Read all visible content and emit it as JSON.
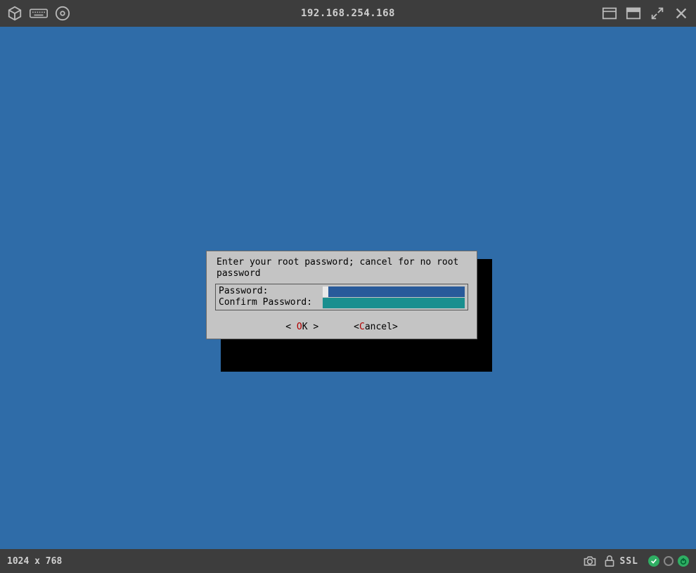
{
  "topbar": {
    "title": "192.168.254.168"
  },
  "dialog": {
    "message": "Enter your root password; cancel for no root password",
    "password_label": "Password:",
    "confirm_label": "Confirm Password:",
    "password_value": "",
    "confirm_value": "",
    "ok_left": "< ",
    "ok_hot": "O",
    "ok_rest": "K",
    "ok_right": " >",
    "cancel_left": "<",
    "cancel_hot": "C",
    "cancel_rest": "ancel",
    "cancel_right": ">"
  },
  "bottombar": {
    "resolution": "1024 x 768",
    "ssl": "SSL"
  }
}
